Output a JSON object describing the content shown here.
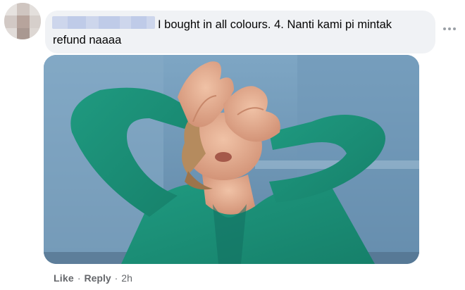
{
  "comment": {
    "text": "I bought in all colours. 4. Nanti kami pi mintak refund naaaa",
    "media_icon": "gif-image"
  },
  "actions": {
    "like_label": "Like",
    "reply_label": "Reply",
    "separator": "·",
    "timestamp": "2h"
  },
  "icons": {
    "more": "more-options-icon",
    "avatar": "avatar"
  },
  "colors": {
    "bubble_bg": "#f0f2f5",
    "text": "#050505",
    "meta_text": "#65676b",
    "name_blur": "#cdd6ec"
  }
}
